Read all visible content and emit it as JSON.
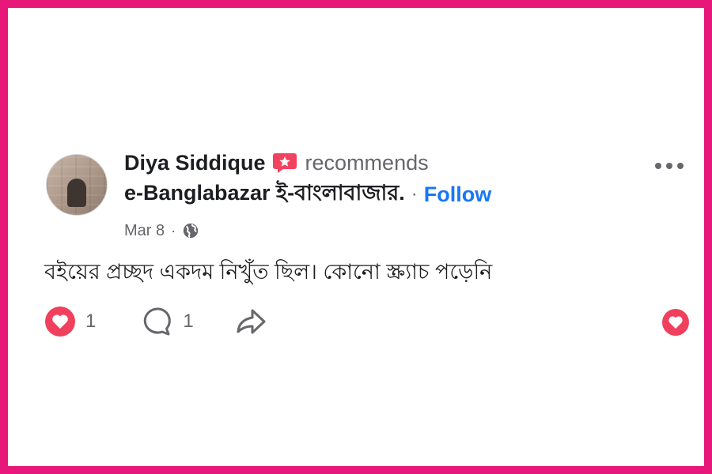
{
  "post": {
    "author": "Diya Siddique",
    "action": "recommends",
    "page_name": "e-Banglabazar ই-বাংলাবাজার.",
    "separator": "·",
    "follow_label": "Follow",
    "date": "Mar 8",
    "date_separator": "·",
    "text": "বইয়ের প্রচ্ছদ একদম নিখুঁত ছিল। কোনো স্ক্র্যাচ পড়েনি"
  },
  "actions": {
    "reaction_count": "1",
    "comment_count": "1"
  },
  "icons": {
    "recommend": "recommend-star-icon",
    "privacy": "globe-icon",
    "more": "more-options-icon",
    "reaction": "heart-reaction-icon",
    "comment": "comment-icon",
    "share": "share-icon"
  },
  "colors": {
    "border": "#e8177a",
    "follow": "#1877f2",
    "heart": "#f0405e",
    "recommend": "#f3425f",
    "muted": "#65676b"
  }
}
